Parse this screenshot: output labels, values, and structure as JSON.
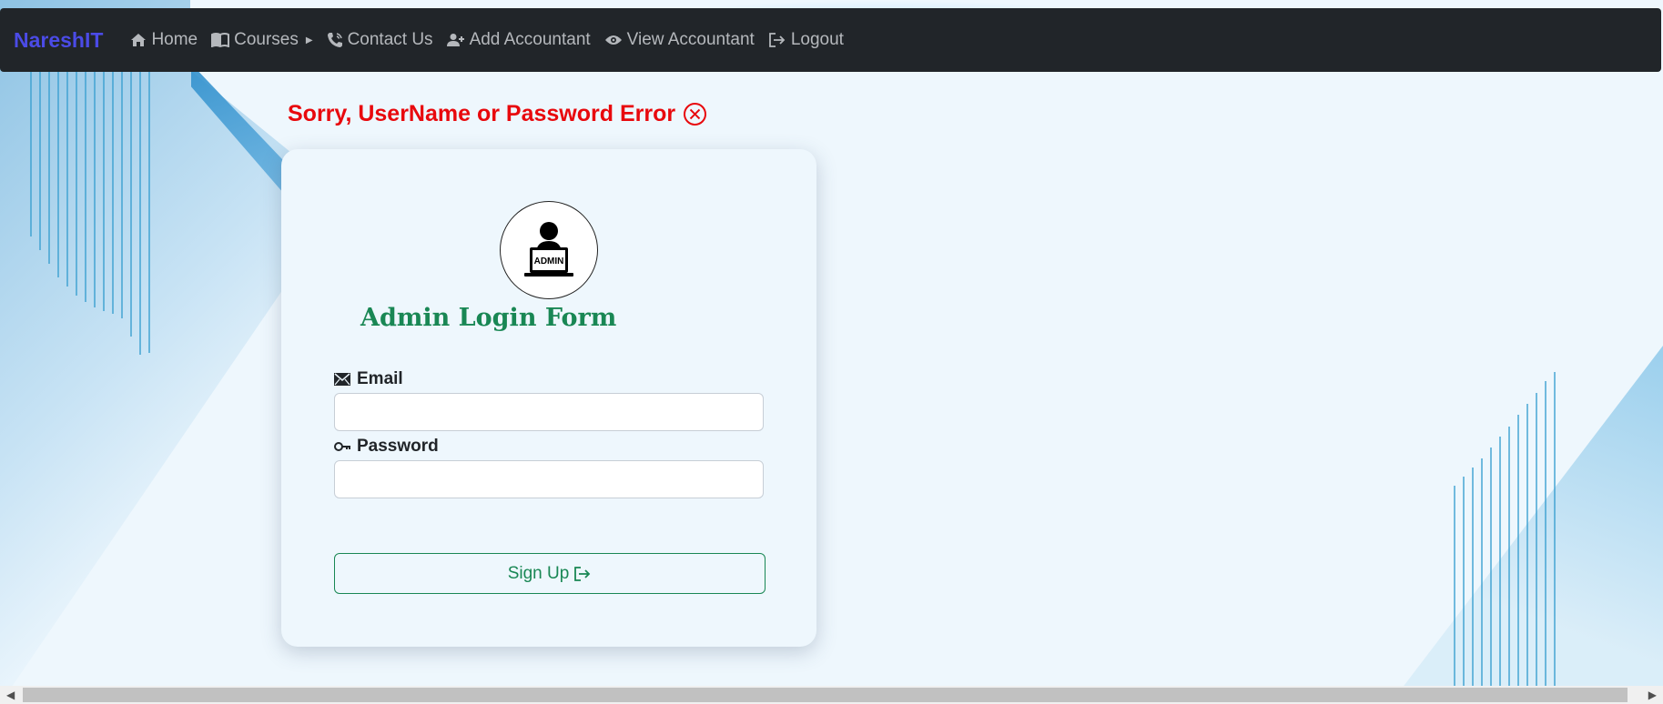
{
  "navbar": {
    "brand": "NareshIT",
    "items": [
      {
        "label": "Home",
        "icon": "home-icon"
      },
      {
        "label": "Courses",
        "icon": "book-icon",
        "has_caret": true
      },
      {
        "label": "Contact Us",
        "icon": "phone-icon"
      },
      {
        "label": "Add Accountant",
        "icon": "user-plus-icon"
      },
      {
        "label": "View Accountant",
        "icon": "eye-icon"
      },
      {
        "label": "Logout",
        "icon": "logout-icon"
      }
    ]
  },
  "error": {
    "message": "Sorry, UserName or Password Error",
    "icon": "x-circle-icon"
  },
  "form": {
    "avatar_text": "ADMIN",
    "title": "Admin Login Form",
    "email_label": "Email",
    "email_value": "",
    "password_label": "Password",
    "password_value": "",
    "submit_label": "Sign Up"
  },
  "colors": {
    "navbar_bg": "#212529",
    "brand": "#4b4be6",
    "error": "#e8090d",
    "accent_green": "#198754"
  }
}
